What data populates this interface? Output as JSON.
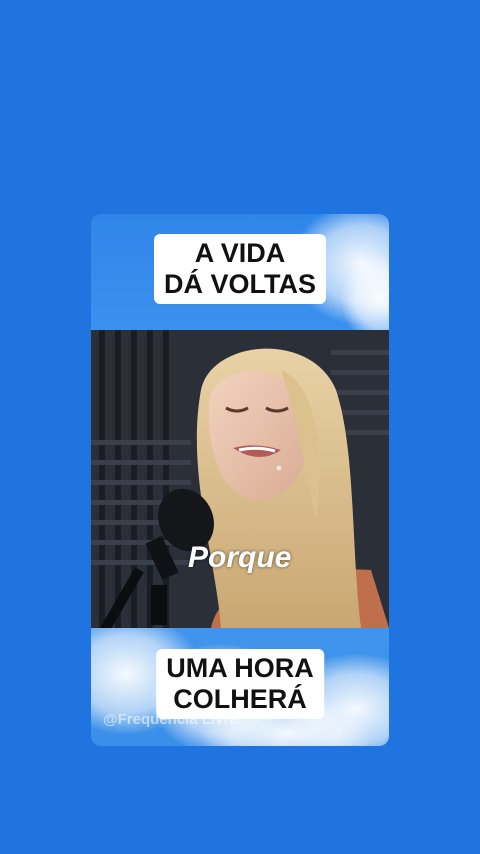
{
  "top_caption": {
    "line1": "A VIDA",
    "line2": "DÁ VOLTAS"
  },
  "subtitle": "Porque",
  "bottom_caption": {
    "line1": "UMA HORA",
    "line2": "COLHERÁ"
  },
  "watermark": "@Frequencia Livre",
  "colors": {
    "background": "#1f74e0",
    "caption_bg": "#ffffff",
    "caption_text": "#111111"
  }
}
